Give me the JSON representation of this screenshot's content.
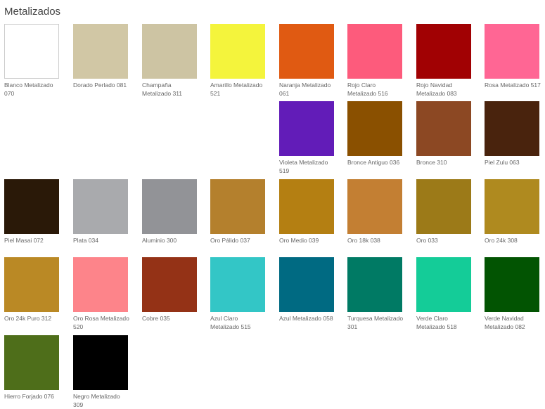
{
  "page": {
    "title": "Metalizados"
  },
  "swatches": [
    {
      "name": "Blanco Metalizado 070",
      "color": "#ffffff"
    },
    {
      "name": "Dorado Perlado 081",
      "color": "#d1c7a5"
    },
    {
      "name": "Champaña Metalizado 311",
      "color": "#cdc4a3"
    },
    {
      "name": "Amarillo Metalizado 521",
      "color": "#f4f43c"
    },
    {
      "name": "Naranja Metalizado 061",
      "color": "#e05a12"
    },
    {
      "name": "Rojo Claro Metalizado 516",
      "color": "#fd5b7c"
    },
    {
      "name": "Rojo Navidad Metalizado 083",
      "color": "#a10103"
    },
    {
      "name": "Rosa Metalizado 517",
      "color": "#ff6694"
    },
    {
      "name": "Violeta Metalizado 519",
      "color": "#621cb8"
    },
    {
      "name": "Bronce Antiguo 036",
      "color": "#8a5000"
    },
    {
      "name": "Bronce 310",
      "color": "#8c4823"
    },
    {
      "name": "Piel Zulu 063",
      "color": "#49230d"
    },
    {
      "name": "Piel Masai 072",
      "color": "#2a1908"
    },
    {
      "name": "Plata 034",
      "color": "#a9aaad"
    },
    {
      "name": "Aluminio 300",
      "color": "#929397"
    },
    {
      "name": "Oro Pálido 037",
      "color": "#b4802d"
    },
    {
      "name": "Oro Medio 039",
      "color": "#b47f12"
    },
    {
      "name": "Oro 18k 038",
      "color": "#c37f33"
    },
    {
      "name": "Oro 033",
      "color": "#9c7a18"
    },
    {
      "name": "Oro 24k 308",
      "color": "#af8a1f"
    },
    {
      "name": "Oro 24k Puro 312",
      "color": "#ba8925"
    },
    {
      "name": "Oro Rosa Metalizado 520",
      "color": "#fd848a"
    },
    {
      "name": "Cobre 035",
      "color": "#943216"
    },
    {
      "name": "Azul Claro Metalizado 515",
      "color": "#33c6c6"
    },
    {
      "name": "Azul Metalizado 058",
      "color": "#006a82"
    },
    {
      "name": "Turquesa Metalizado 301",
      "color": "#007a64"
    },
    {
      "name": "Verde Claro Metalizado 518",
      "color": "#14cc98"
    },
    {
      "name": "Verde Navidad Metalizado 082",
      "color": "#025402"
    },
    {
      "name": "Hierro Forjado 076",
      "color": "#4e6e1a"
    },
    {
      "name": "Negro Metalizado 309",
      "color": "#000000"
    }
  ]
}
